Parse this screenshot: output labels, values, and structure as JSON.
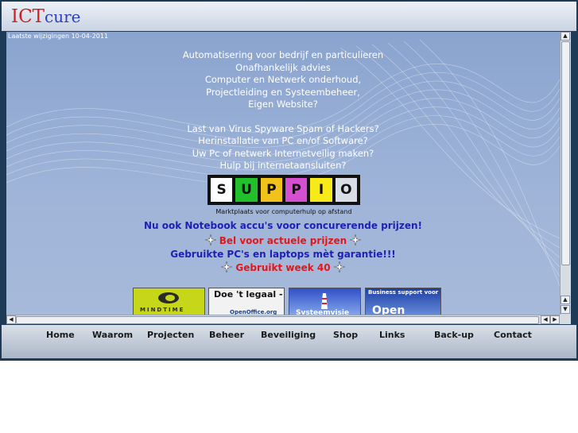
{
  "header": {
    "brand_part1": "ICT",
    "brand_part2": "cure"
  },
  "last_modified": "Laatste wijzigingen 10-04-2011",
  "intro_lines": [
    "Automatisering voor bedrijf en particulieren",
    "Onafhankelijk advies",
    "Computer en Netwerk onderhoud,",
    "Projectleiding en Systeembeheer,",
    "Eigen Website?"
  ],
  "question_lines": [
    "Last van Virus Spyware Spam of Hackers?",
    "Herinstallatie van PC en/of Software?",
    "Uw Pc of netwerk Internetveilig maken?",
    "Hulp bij internetaansluiten?"
  ],
  "suppio": {
    "letters": [
      "S",
      "U",
      "P",
      "P",
      "I",
      "O"
    ],
    "tagline": "Marktplaats voor computerhulp op afstand",
    "colors": [
      "#ffffff",
      "#22c02a",
      "#f2c21c",
      "#d54fd1",
      "#f7ea18",
      "#d9dde6"
    ]
  },
  "promos": {
    "notebook": "Nu ook Notebook accu's voor concurerende prijzen!",
    "prices": "Bel voor actuele prijzen",
    "used": "Gebruikte PC's en laptops mèt garantie!!!",
    "week": "Gebruikt week 40"
  },
  "banners": {
    "mindtime": "MINDTIME",
    "legal_title": "Doe 't legaal -",
    "legal_sub": "OpenOffice.org",
    "sys": "Systeemvisie",
    "open_title": "Business support voor",
    "open_sub": "Open"
  },
  "scroll": {
    "up": "▲",
    "down": "▼",
    "left": "◀",
    "right": "▶"
  },
  "nav": [
    "Home",
    "Waarom",
    "Projecten",
    "Beheer",
    "Beveiliging",
    "Shop",
    "Links",
    "Back-up",
    "Contact"
  ],
  "colors": {
    "brand_red": "#d01f1f",
    "brand_blue": "#2b3fbf",
    "promo_blue": "#2020b8",
    "promo_red": "#e0181b"
  },
  "icons": {
    "sparkle": "sparkle-icon"
  }
}
